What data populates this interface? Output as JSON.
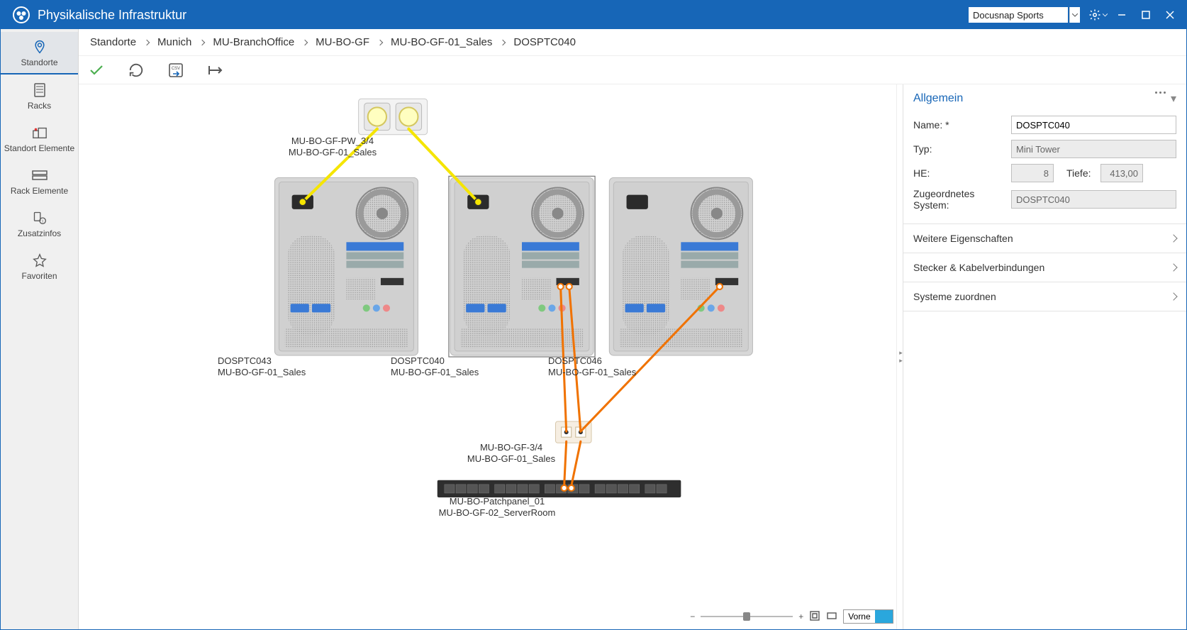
{
  "title": "Physikalische Infrastruktur",
  "search_value": "Docusnap Sports",
  "leftnav": [
    {
      "label": "Standorte",
      "active": true
    },
    {
      "label": "Racks",
      "active": false
    },
    {
      "label": "Standort Elemente",
      "active": false
    },
    {
      "label": "Rack Elemente",
      "active": false
    },
    {
      "label": "Zusatzinfos",
      "active": false
    },
    {
      "label": "Favoriten",
      "active": false
    }
  ],
  "breadcrumb": [
    "Standorte",
    "Munich",
    "MU-BranchOffice",
    "MU-BO-GF",
    "MU-BO-GF-01_Sales",
    "DOSPTC040"
  ],
  "nodes": {
    "outlet_top": {
      "line1": "MU-BO-GF-PW_3/4",
      "line2": "MU-BO-GF-01_Sales"
    },
    "pc_left": {
      "line1": "DOSPTC043",
      "line2": "MU-BO-GF-01_Sales"
    },
    "pc_mid": {
      "line1": "DOSPTC040",
      "line2": "MU-BO-GF-01_Sales"
    },
    "pc_right": {
      "line1": "DOSPTC046",
      "line2": "MU-BO-GF-01_Sales"
    },
    "outlet_mid": {
      "line1": "MU-BO-GF-3/4",
      "line2": "MU-BO-GF-01_Sales"
    },
    "patch": {
      "line1": "MU-BO-Patchpanel_01",
      "line2": "MU-BO-GF-02_ServerRoom"
    }
  },
  "right": {
    "section": "Allgemein",
    "name_label": "Name: *",
    "name_value": "DOSPTC040",
    "typ_label": "Typ:",
    "typ_value": "Mini Tower",
    "he_label": "HE:",
    "he_value": "8",
    "tiefe_label": "Tiefe:",
    "tiefe_value": "413,00",
    "sys_label": "Zugeordnetes System:",
    "sys_value": "DOSPTC040",
    "collapsers": [
      "Weitere Eigenschaften",
      "Stecker & Kabelverbindungen",
      "Systeme zuordnen"
    ]
  },
  "zoom": {
    "front": "Vorne"
  }
}
